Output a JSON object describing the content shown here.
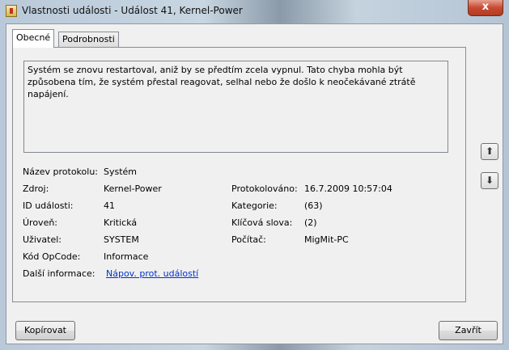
{
  "window": {
    "title": "Vlastnosti události - Událost 41, Kernel-Power",
    "close_label": "x"
  },
  "tabs": [
    {
      "label": "Obecné"
    },
    {
      "label": "Podrobnosti"
    }
  ],
  "description": "Systém se znovu restartoval, aniž by se předtím zcela vypnul. Tato chyba mohla být způsobena tím, že systém přestal reagovat, selhal nebo že došlo k neočekávané ztrátě napájení.",
  "fields": {
    "log_name": {
      "label": "Název protokolu:",
      "value": "Systém"
    },
    "source": {
      "label": "Zdroj:",
      "value": "Kernel-Power"
    },
    "logged": {
      "label": "Protokolováno:",
      "value": "16.7.2009 10:57:04"
    },
    "event_id": {
      "label": "ID události:",
      "value": "41"
    },
    "category": {
      "label": "Kategorie:",
      "value": "(63)"
    },
    "level": {
      "label": "Úroveň:",
      "value": "Kritická"
    },
    "keywords": {
      "label": "Klíčová slova:",
      "value": "(2)"
    },
    "user": {
      "label": "Uživatel:",
      "value": "SYSTEM"
    },
    "computer": {
      "label": "Počítač:",
      "value": "MigMit-PC"
    },
    "opcode": {
      "label": "Kód OpCode:",
      "value": "Informace"
    },
    "more_info": {
      "label": "Další informace:",
      "value": "Nápov. prot. událostí"
    }
  },
  "icons": {
    "up": "arrow-up-icon",
    "down": "arrow-down-icon"
  },
  "buttons": {
    "copy": "Kopírovat",
    "close": "Zavřít"
  }
}
